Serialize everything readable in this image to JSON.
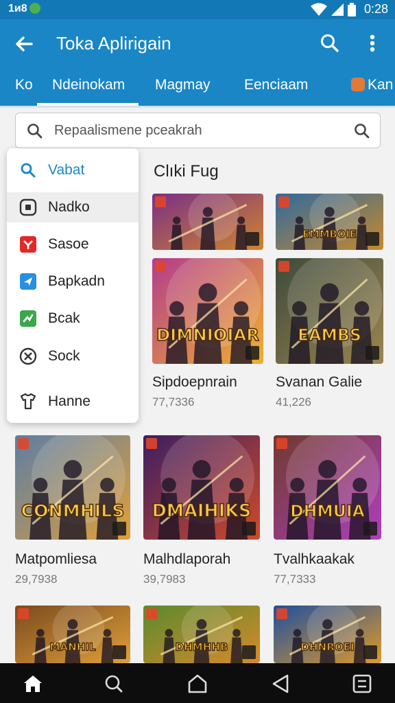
{
  "status_bar": {
    "left_text": "1ᴎ8",
    "time": "0:28"
  },
  "app_bar": {
    "title": "Toka Aplirigain"
  },
  "tabs": [
    {
      "label": "Ko"
    },
    {
      "label": "Ndeinokam",
      "selected": true
    },
    {
      "label": "Magmay"
    },
    {
      "label": "Eenciaam"
    },
    {
      "label": "Kan"
    }
  ],
  "search": {
    "placeholder": "Repaalismene pceakrah"
  },
  "menu": {
    "items": [
      {
        "label": "Vabat",
        "icon": "search-icon",
        "accent": true
      },
      {
        "label": "Nadko",
        "icon": "gamepad-icon",
        "selected": true
      },
      {
        "label": "Sasoe",
        "icon": "red-app-icon"
      },
      {
        "label": "Bapkadn",
        "icon": "blue-app-icon"
      },
      {
        "label": "Bcak",
        "icon": "green-app-icon"
      },
      {
        "label": "Sock",
        "icon": "cancel-circle-icon"
      },
      {
        "label": "Hanne",
        "icon": "shirt-icon"
      }
    ]
  },
  "section_title": "Clıki Fug",
  "games": [
    {
      "title": "",
      "count": "",
      "art_text": "",
      "palette": [
        "#7a2f86",
        "#d0852e"
      ]
    },
    {
      "title": "",
      "count": "",
      "art_text": "EMMBOIE",
      "palette": [
        "#2f6a9e",
        "#c8892c"
      ]
    },
    {
      "title": "Sipdoepnrain",
      "count": "77,7336",
      "art_text": "DIMNIOIAR",
      "palette": [
        "#b33c8c",
        "#f0b12e"
      ]
    },
    {
      "title": "Svanan Galie",
      "count": "41,226",
      "art_text": "EAMBS",
      "palette": [
        "#3e4a3a",
        "#9c8650"
      ]
    },
    {
      "title": "Matpomliesa",
      "count": "29,7938",
      "art_text": "CONMHILS",
      "palette": [
        "#5c7ea4",
        "#e0a03a"
      ]
    },
    {
      "title": "Malhdlaporah",
      "count": "39,7983",
      "art_text": "DMAIHIKS",
      "palette": [
        "#3b1e63",
        "#d04a2a"
      ]
    },
    {
      "title": "Tvalhkaakak",
      "count": "77,7333",
      "art_text": "DHMUIA",
      "palette": [
        "#6f3a2e",
        "#b03fbd"
      ]
    },
    {
      "title": "",
      "count": "",
      "art_text": "MANHIL",
      "palette": [
        "#7b4a1f",
        "#e0a03a"
      ]
    },
    {
      "title": "",
      "count": "",
      "art_text": "DHMHHB",
      "palette": [
        "#5a8a2e",
        "#d88a2a"
      ]
    },
    {
      "title": "",
      "count": "",
      "art_text": "DHNROEI",
      "palette": [
        "#1e4f9e",
        "#e09a2a"
      ]
    }
  ],
  "colors": {
    "status_bar": "#1278b6",
    "app_bar": "#1a86c6",
    "accent": "#1a86c6",
    "nav_bar": "#0d0d0d"
  },
  "nav_bar": {
    "buttons": [
      "home-icon",
      "search-icon",
      "circle-home-icon",
      "back-triangle-icon",
      "recents-icon"
    ]
  }
}
